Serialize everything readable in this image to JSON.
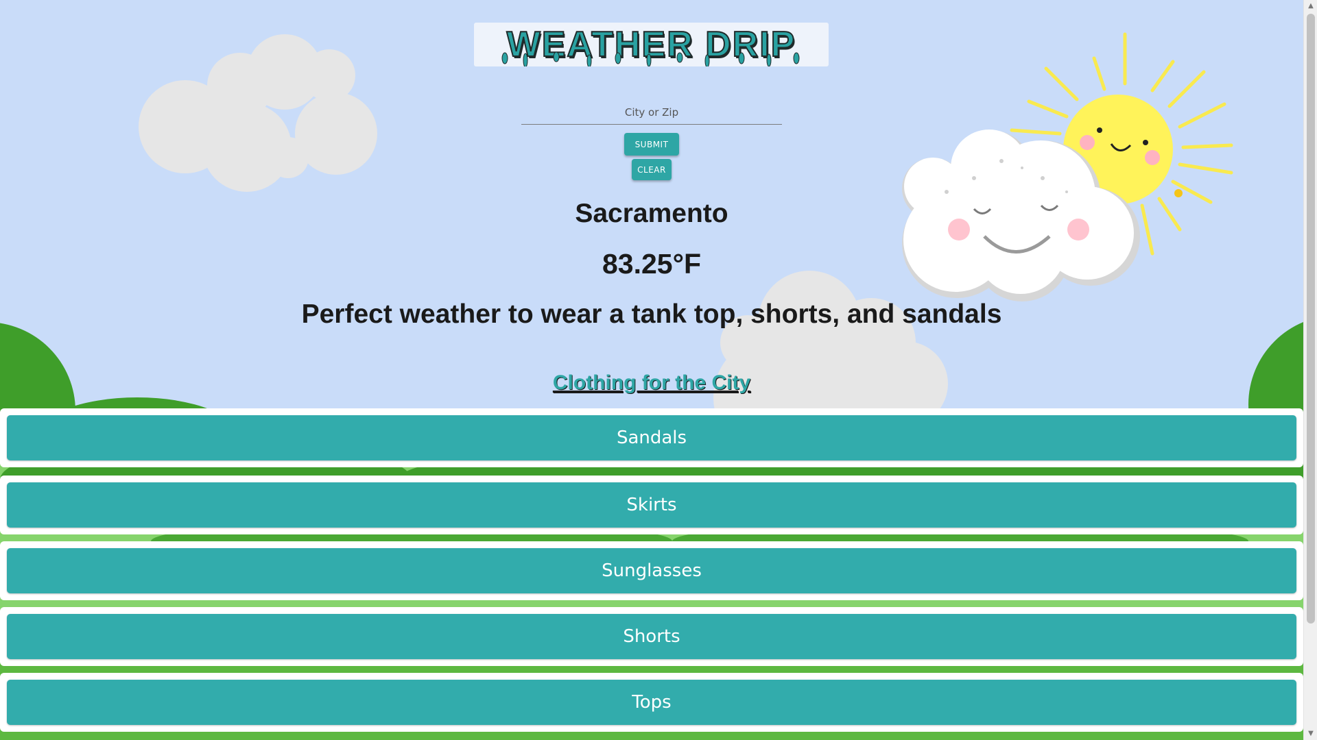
{
  "header": {
    "logo_text": "WEATHER DRIP"
  },
  "search": {
    "placeholder": "City or Zip",
    "value": "",
    "submit_label": "SUBMIT",
    "clear_label": "CLEAR"
  },
  "weather": {
    "city": "Sacramento",
    "temperature": "83.25°F",
    "advice": "Perfect weather to wear a tank top, shorts, and sandals"
  },
  "clothing": {
    "link_label": "Clothing for the City",
    "items": [
      {
        "label": "Sandals"
      },
      {
        "label": "Skirts"
      },
      {
        "label": "Sunglasses"
      },
      {
        "label": "Shorts"
      },
      {
        "label": "Tops"
      }
    ]
  },
  "colors": {
    "sky": "#c9dcf9",
    "accent": "#32acac",
    "grass_dark": "#3f9e2a",
    "grass_light": "#86d46c",
    "cloud": "#e8e8e8",
    "sun": "#fff35a"
  },
  "icons": {
    "scroll_up": "▲",
    "scroll_down": "▼"
  }
}
